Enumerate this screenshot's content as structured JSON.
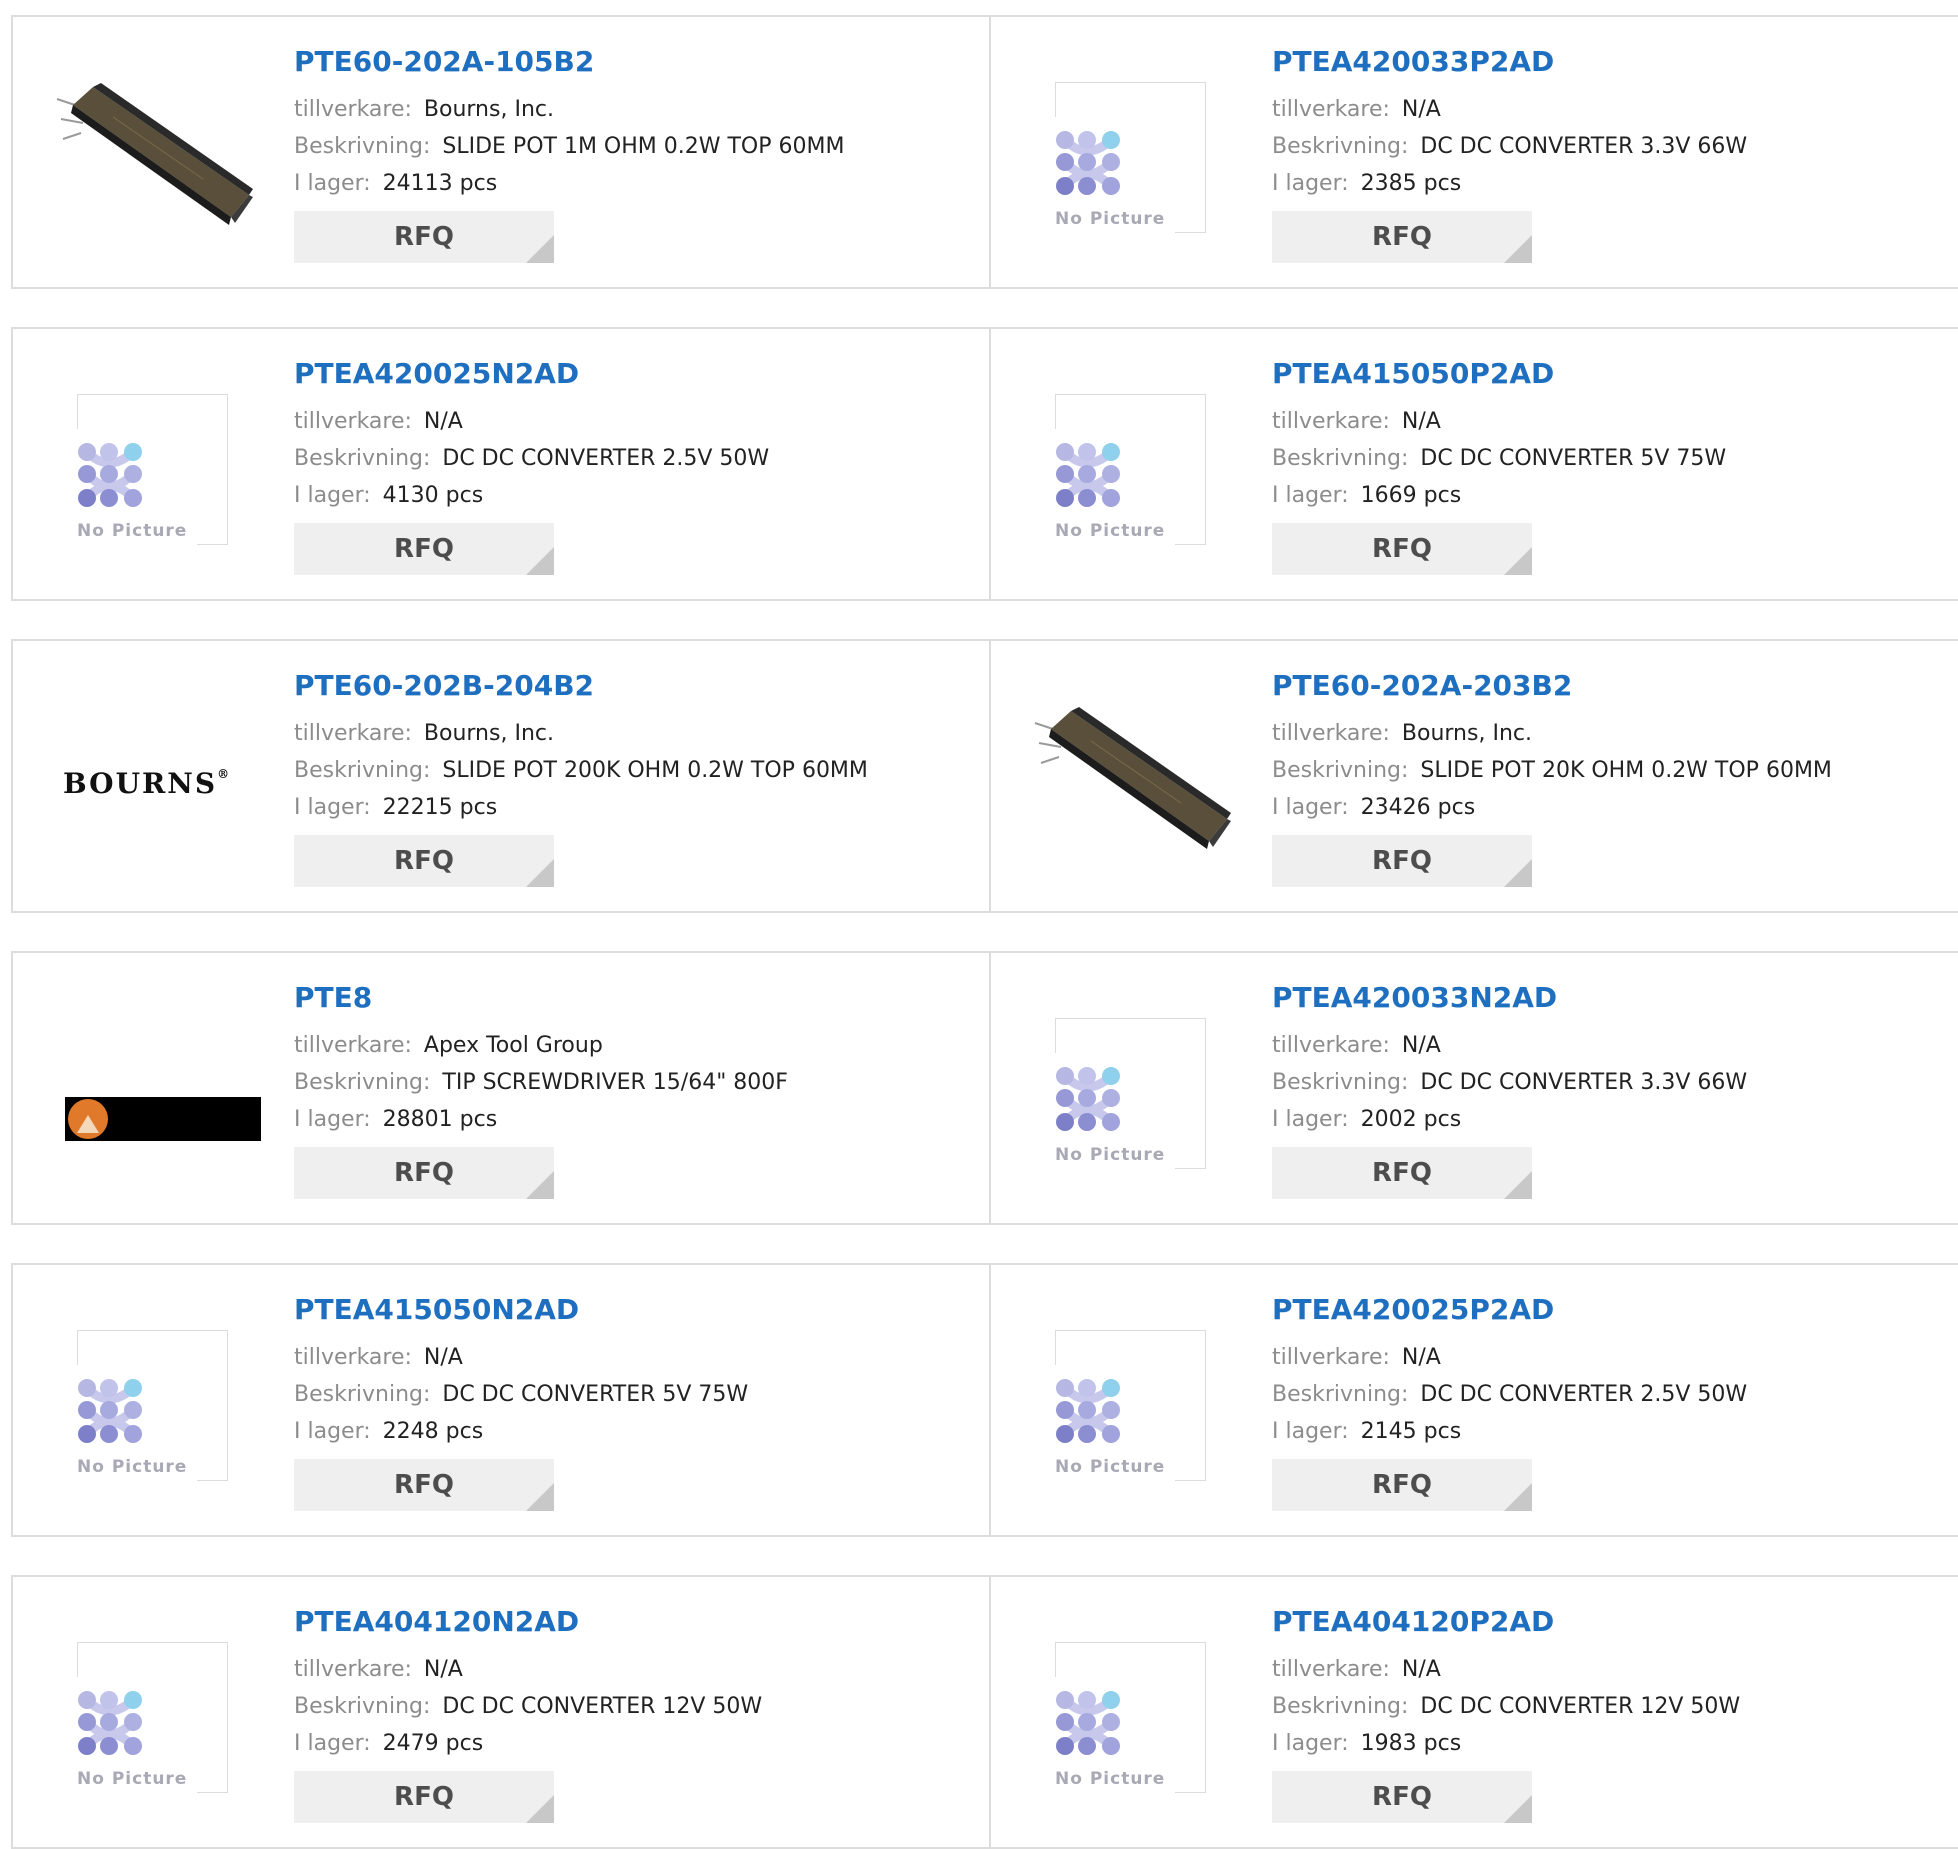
{
  "labels": {
    "manufacturer": "tillverkare:",
    "description": "Beskrivning:",
    "stock": "I lager:",
    "rfq": "RFQ",
    "no_picture": "No Picture"
  },
  "brand_text": {
    "bourns": "BOURNS",
    "registered": "®"
  },
  "colors": {
    "link": "#1e6fbf",
    "label": "#8c8c8c",
    "border": "#dcdcdc",
    "button_bg": "#efefef"
  },
  "products": [
    {
      "part": "PTE60-202A-105B2",
      "manufacturer": "Bourns, Inc.",
      "description": "SLIDE POT 1M OHM 0.2W TOP 60MM",
      "stock": "24113 pcs",
      "image": "slide-pot"
    },
    {
      "part": "PTEA420033P2AD",
      "manufacturer": "N/A",
      "description": "DC DC CONVERTER 3.3V 66W",
      "stock": "2385 pcs",
      "image": "no-picture"
    },
    {
      "part": "PTEA420025N2AD",
      "manufacturer": "N/A",
      "description": "DC DC CONVERTER 2.5V 50W",
      "stock": "4130 pcs",
      "image": "no-picture"
    },
    {
      "part": "PTEA415050P2AD",
      "manufacturer": "N/A",
      "description": "DC DC CONVERTER 5V 75W",
      "stock": "1669 pcs",
      "image": "no-picture"
    },
    {
      "part": "PTE60-202B-204B2",
      "manufacturer": "Bourns, Inc.",
      "description": "SLIDE POT 200K OHM 0.2W TOP 60MM",
      "stock": "22215 pcs",
      "image": "bourns-logo"
    },
    {
      "part": "PTE60-202A-203B2",
      "manufacturer": "Bourns, Inc.",
      "description": "SLIDE POT 20K OHM 0.2W TOP 60MM",
      "stock": "23426 pcs",
      "image": "slide-pot"
    },
    {
      "part": "PTE8",
      "manufacturer": "Apex Tool Group",
      "description": "TIP SCREWDRIVER 15/64\" 800F",
      "stock": "28801 pcs",
      "image": "apex-logo"
    },
    {
      "part": "PTEA420033N2AD",
      "manufacturer": "N/A",
      "description": "DC DC CONVERTER 3.3V 66W",
      "stock": "2002 pcs",
      "image": "no-picture"
    },
    {
      "part": "PTEA415050N2AD",
      "manufacturer": "N/A",
      "description": "DC DC CONVERTER 5V 75W",
      "stock": "2248 pcs",
      "image": "no-picture"
    },
    {
      "part": "PTEA420025P2AD",
      "manufacturer": "N/A",
      "description": "DC DC CONVERTER 2.5V 50W",
      "stock": "2145 pcs",
      "image": "no-picture"
    },
    {
      "part": "PTEA404120N2AD",
      "manufacturer": "N/A",
      "description": "DC DC CONVERTER 12V 50W",
      "stock": "2479 pcs",
      "image": "no-picture"
    },
    {
      "part": "PTEA404120P2AD",
      "manufacturer": "N/A",
      "description": "DC DC CONVERTER 12V 50W",
      "stock": "1983 pcs",
      "image": "no-picture"
    }
  ]
}
